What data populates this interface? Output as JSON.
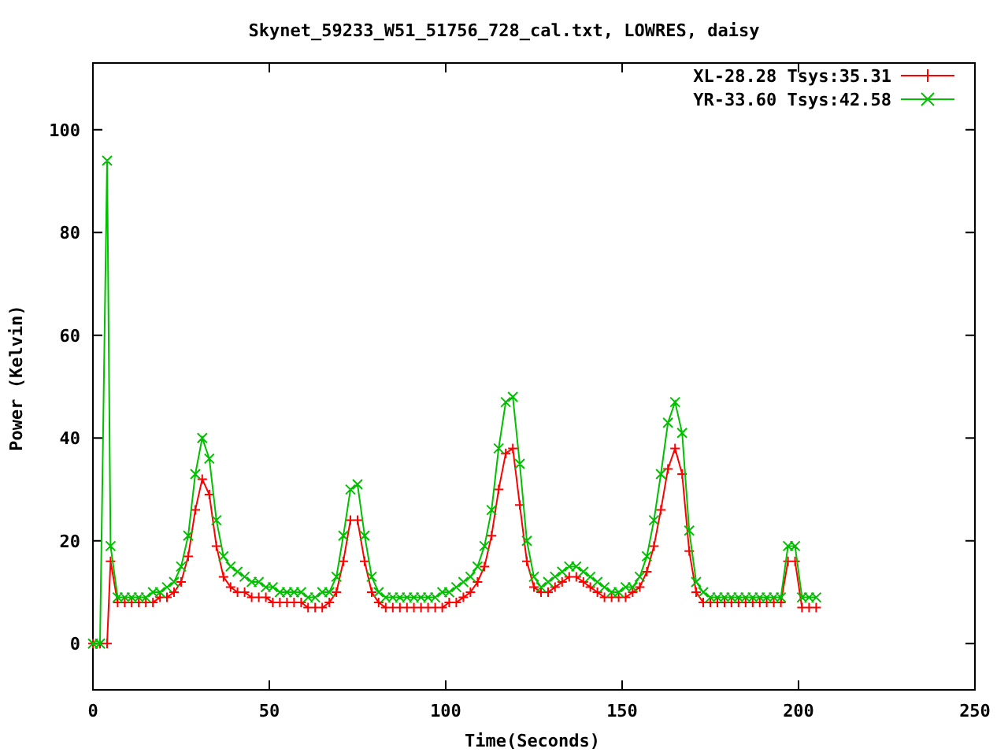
{
  "chart_data": {
    "type": "line",
    "title": "Skynet_59233_W51_51756_728_cal.txt, LOWRES, daisy",
    "xlabel": "Time(Seconds)",
    "ylabel": "Power (Kelvin)",
    "legend": "top-right",
    "xlim": [
      0,
      250
    ],
    "ylim": [
      -9,
      113
    ],
    "xticks": [
      0,
      50,
      100,
      150,
      200,
      250
    ],
    "yticks": [
      0,
      20,
      40,
      60,
      80,
      100
    ],
    "x": [
      0,
      2,
      4,
      5,
      7,
      9,
      11,
      13,
      15,
      17,
      19,
      21,
      23,
      25,
      27,
      29,
      31,
      33,
      35,
      37,
      39,
      41,
      43,
      45,
      47,
      49,
      51,
      53,
      55,
      57,
      59,
      61,
      63,
      65,
      67,
      69,
      71,
      73,
      75,
      77,
      79,
      81,
      83,
      85,
      87,
      89,
      91,
      93,
      95,
      97,
      99,
      101,
      103,
      105,
      107,
      109,
      111,
      113,
      115,
      117,
      119,
      121,
      123,
      125,
      127,
      129,
      131,
      133,
      135,
      137,
      139,
      141,
      143,
      145,
      147,
      149,
      151,
      153,
      155,
      157,
      159,
      161,
      163,
      165,
      167,
      169,
      171,
      173,
      175,
      177,
      179,
      181,
      183,
      185,
      187,
      189,
      191,
      193,
      195,
      197,
      199,
      201,
      203,
      205
    ],
    "series": [
      {
        "name": "XL-28.28 Tsys:35.31",
        "color": "#ff0000",
        "marker": "plus",
        "values": [
          0,
          0,
          0,
          16,
          8,
          8,
          8,
          8,
          8,
          8,
          9,
          9,
          10,
          12,
          17,
          26,
          32,
          29,
          19,
          13,
          11,
          10,
          10,
          9,
          9,
          9,
          8,
          8,
          8,
          8,
          8,
          7,
          7,
          7,
          8,
          10,
          16,
          24,
          24,
          16,
          10,
          8,
          7,
          7,
          7,
          7,
          7,
          7,
          7,
          7,
          7,
          8,
          8,
          9,
          10,
          12,
          15,
          21,
          30,
          37,
          38,
          27,
          16,
          11,
          10,
          10,
          11,
          12,
          13,
          13,
          12,
          11,
          10,
          9,
          9,
          9,
          9,
          10,
          11,
          14,
          19,
          26,
          34,
          38,
          33,
          18,
          10,
          8,
          8,
          8,
          8,
          8,
          8,
          8,
          8,
          8,
          8,
          8,
          8,
          16,
          16,
          7,
          7,
          7
        ]
      },
      {
        "name": "YR-33.60 Tsys:42.58",
        "color": "#00c000",
        "marker": "cross",
        "values": [
          0,
          0,
          94,
          19,
          9,
          9,
          9,
          9,
          9,
          10,
          10,
          11,
          12,
          15,
          21,
          33,
          40,
          36,
          24,
          17,
          15,
          14,
          13,
          12,
          12,
          11,
          11,
          10,
          10,
          10,
          10,
          9,
          9,
          10,
          10,
          13,
          21,
          30,
          31,
          21,
          13,
          10,
          9,
          9,
          9,
          9,
          9,
          9,
          9,
          9,
          10,
          10,
          11,
          12,
          13,
          15,
          19,
          26,
          38,
          47,
          48,
          35,
          20,
          13,
          11,
          12,
          13,
          14,
          15,
          15,
          14,
          13,
          12,
          11,
          10,
          10,
          11,
          11,
          13,
          17,
          24,
          33,
          43,
          47,
          41,
          22,
          12,
          10,
          9,
          9,
          9,
          9,
          9,
          9,
          9,
          9,
          9,
          9,
          9,
          19,
          19,
          9,
          9,
          9
        ]
      }
    ]
  }
}
